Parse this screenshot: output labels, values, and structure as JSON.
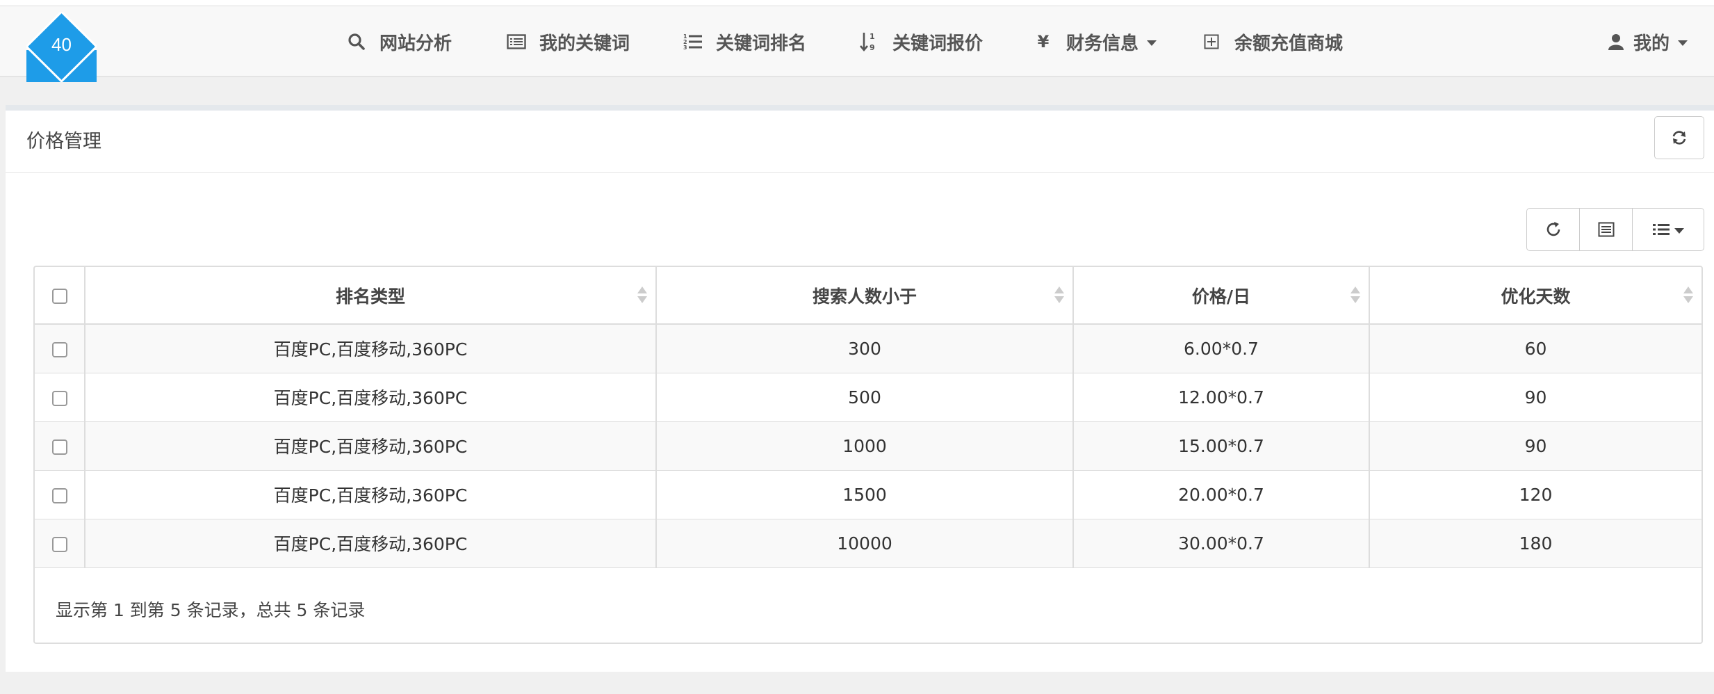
{
  "logo": {
    "badge_number": "40",
    "color": "#1e9ce8"
  },
  "nav": {
    "items": [
      {
        "label": "网站分析",
        "icon": "search-icon"
      },
      {
        "label": "我的关键词",
        "icon": "list-alt-icon"
      },
      {
        "label": "关键词排名",
        "icon": "ordered-list-icon"
      },
      {
        "label": "关键词报价",
        "icon": "sort-numeric-icon"
      },
      {
        "label": "财务信息",
        "icon": "yen-icon",
        "dropdown": true
      },
      {
        "label": "余额充值商城",
        "icon": "plus-square-icon"
      }
    ],
    "user": {
      "label": "我的",
      "icon": "user-icon"
    }
  },
  "panel": {
    "title": "价格管理"
  },
  "table": {
    "columns": [
      "排名类型",
      "搜索人数小于",
      "价格/日",
      "优化天数"
    ],
    "rows": [
      [
        "百度PC,百度移动,360PC",
        "300",
        "6.00*0.7",
        "60"
      ],
      [
        "百度PC,百度移动,360PC",
        "500",
        "12.00*0.7",
        "90"
      ],
      [
        "百度PC,百度移动,360PC",
        "1000",
        "15.00*0.7",
        "90"
      ],
      [
        "百度PC,百度移动,360PC",
        "1500",
        "20.00*0.7",
        "120"
      ],
      [
        "百度PC,百度移动,360PC",
        "10000",
        "30.00*0.7",
        "180"
      ]
    ]
  },
  "pagination": {
    "summary": "显示第 1 到第 5 条记录，总共 5 条记录"
  }
}
